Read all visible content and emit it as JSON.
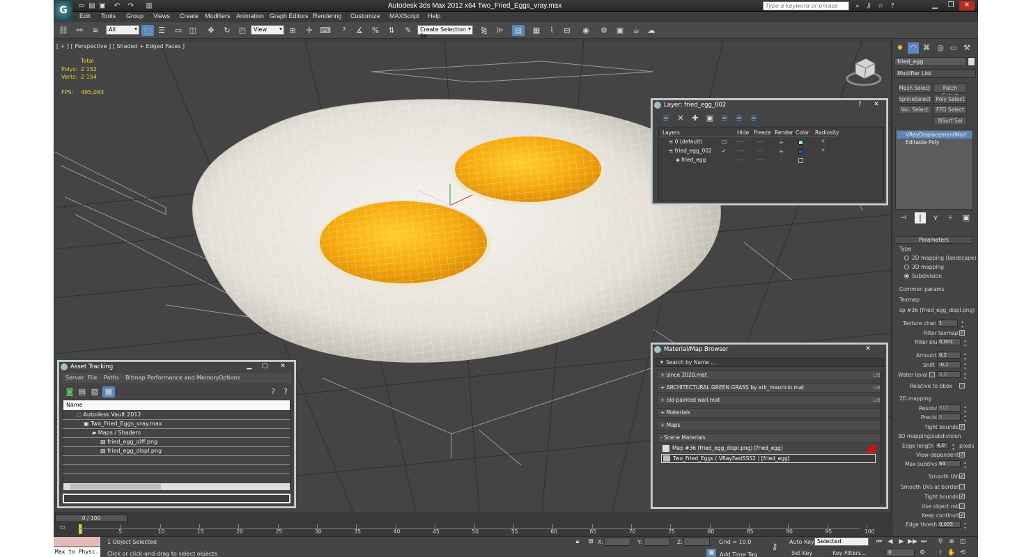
{
  "window": {
    "title": "Autodesk 3ds Max  2012 x64     Two_Fried_Eggs_vray.max",
    "search_placeholder": "Type a keyword or phrase"
  },
  "menu": [
    "Edit",
    "Tools",
    "Group",
    "Views",
    "Create",
    "Modifiers",
    "Animation",
    "Graph Editors",
    "Rendering",
    "Customize",
    "MAXScript",
    "Help"
  ],
  "toolbar": {
    "selection_filter": "All",
    "ref_coord": "View",
    "named_selection": "Create Selection Se"
  },
  "viewport": {
    "label": "[ + ] [ Perspective ] [ Shaded + Edged Faces ]",
    "stats_header": "Total",
    "polys_label": "Polys:",
    "polys_value": "2 152",
    "verts_label": "Verts:",
    "verts_value": "2 154",
    "fps_label": "FPS:",
    "fps_value": "495,093"
  },
  "command_panel": {
    "object_name": "fried_egg",
    "modifier_list": "Modifier List",
    "buttons": [
      "Mesh Select",
      "Patch Select",
      "SplineSelect",
      "Poly Select",
      "Vol. Select",
      "FFD Select",
      "NSurf Sel"
    ],
    "stack": [
      "VRayDisplacementMod",
      "Editable Poly"
    ],
    "parameters_title": "Parameters",
    "type_label": "Type",
    "type_options": [
      "2D mapping (landscape)",
      "3D mapping",
      "Subdivision"
    ],
    "common_params": "Common params",
    "texmap_label": "Texmap",
    "texmap_value": "sp #36 (fried_egg_displ.png)",
    "texture_chan_label": "Texture chan",
    "texture_chan_value": "1",
    "filter_texmap": "Filter texmap",
    "filter_blur_label": "Filter blur",
    "filter_blur_value": "0,001",
    "amount_label": "Amount",
    "amount_value": "0,2",
    "shift_label": "Shift",
    "shift_value": "-0,1",
    "water_level_label": "Water level",
    "water_level_value": "0,0",
    "relative_bbox": "Relative to bbox",
    "mapping2d_label": "2D mapping",
    "resolution_label": "Resolution",
    "resolution_value": "512",
    "precision_label": "Precision",
    "precision_value": "8",
    "tight_bounds_2d": "Tight bounds",
    "mapping3d_label": "3D mapping/subdivision",
    "edge_length_label": "Edge length",
    "edge_length_value": "4,0",
    "pixels_label": "pixels",
    "view_dependent": "View-dependent",
    "max_subdivs_label": "Max subdivs",
    "max_subdivs_value": "64",
    "smooth_uvs": "Smooth UVs",
    "smooth_uvs_borders": "Smooth UVs at borders",
    "tight_bounds_3d": "Tight bounds",
    "use_object_mtl": "Use object mtl",
    "keep_continuity": "Keep continuity",
    "edge_thresh_label": "Edge thresh",
    "edge_thresh_value": "0,005"
  },
  "layer_window": {
    "title": "Layer: fried_egg_002",
    "columns": [
      "Layers",
      "Hide",
      "Freeze",
      "Render",
      "Color",
      "Radiosity"
    ],
    "rows": [
      {
        "name": "0 (default)",
        "color": "#9fe6d8"
      },
      {
        "name": "fried_egg_002",
        "color": "#1c5aa6"
      },
      {
        "name": "fried_egg",
        "color": ""
      }
    ]
  },
  "asset_tracking": {
    "title": "Asset Tracking",
    "menu": [
      "Server",
      "File",
      "Paths",
      "Bitmap Performance and Memory",
      "Options"
    ],
    "column": "Name",
    "rows": [
      "Autodesk Vault 2012",
      "Two_Fried_Eggs_vray.max",
      "Maps / Shaders",
      "fried_egg_diff.png",
      "fried_egg_displ.png"
    ]
  },
  "material_browser": {
    "title": "Material/Map Browser",
    "search_placeholder": "Search by Name ...",
    "groups": [
      {
        "label": "+ since 2020.mat",
        "tag": "LIB"
      },
      {
        "label": "+ ARCHITECTURAL GREEN GRASS by ark_mauricio.mat",
        "tag": "LIB"
      },
      {
        "label": "+ old painted wall.mat",
        "tag": "LIB"
      },
      {
        "label": "+ Materials",
        "tag": ""
      },
      {
        "label": "+ Maps",
        "tag": ""
      },
      {
        "label": "- Scene Materials",
        "tag": ""
      }
    ],
    "scene_items": [
      "Map #36 (fried_egg_displ.png)  [fried_egg]",
      "Two_Fried_Eggs  ( VRayFastSSS2 )  [fried_egg]"
    ]
  },
  "timeline": {
    "slider": "0 / 100",
    "ticks": [
      "0",
      "5",
      "10",
      "15",
      "20",
      "25",
      "30",
      "35",
      "40",
      "45",
      "50",
      "55",
      "60",
      "65",
      "70",
      "75",
      "80",
      "85",
      "90",
      "95",
      "100"
    ]
  },
  "status": {
    "maxscript": "Max to Physc.",
    "selection": "1 Object Selected",
    "prompt": "Click or click-and-drag to select objects",
    "x_label": "X:",
    "y_label": "Y:",
    "z_label": "Z:",
    "grid": "Grid = 10,0",
    "auto_key": "Auto Key",
    "set_key": "Set Key",
    "key_mode": "Selected",
    "key_filters": "Key Filters...",
    "add_time_tag": "Add Time Tag",
    "frame": "0"
  }
}
